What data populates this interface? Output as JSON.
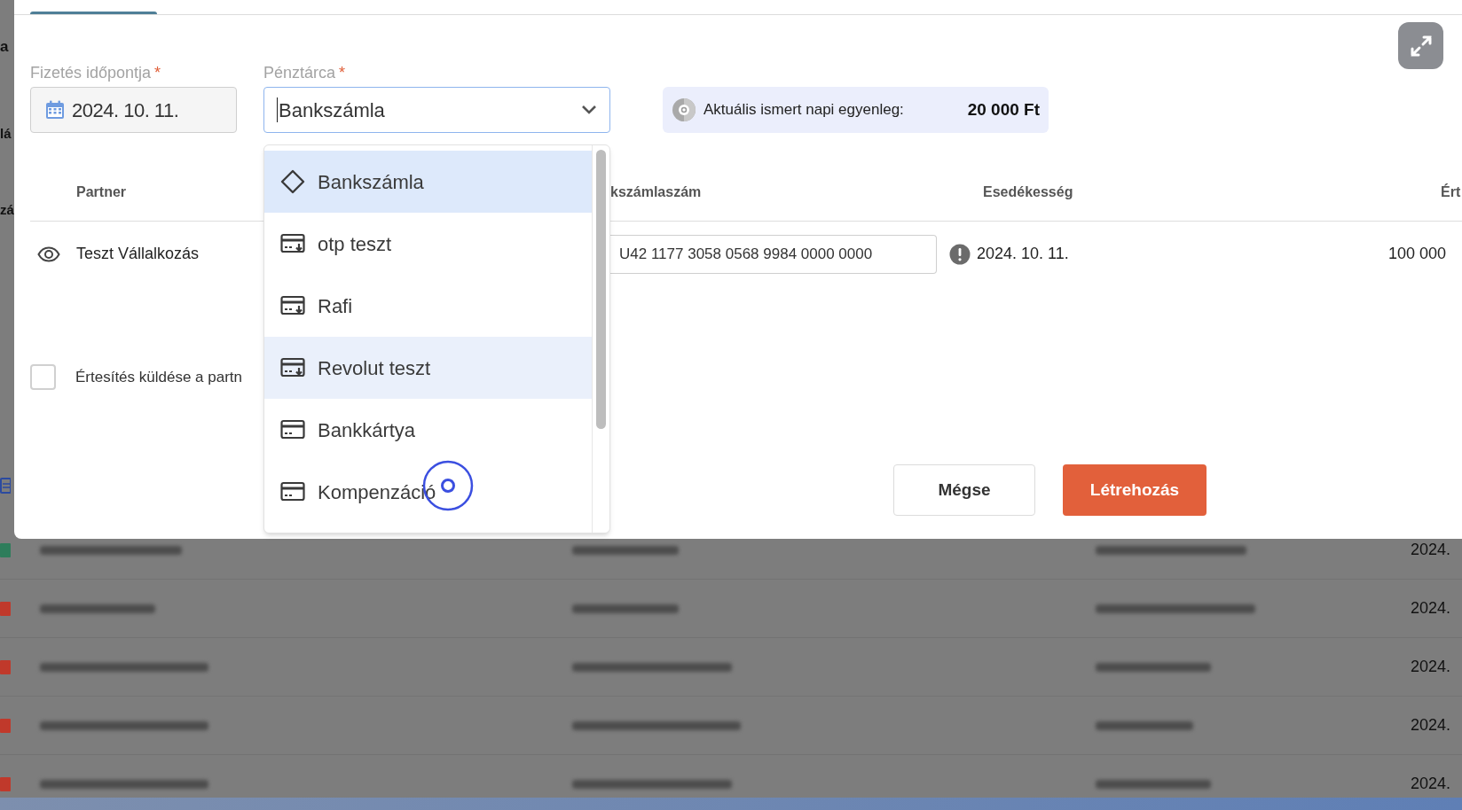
{
  "background": {
    "side_labels": [
      "a",
      "lá",
      "zá"
    ],
    "rows": [
      {
        "color": "#2e7d5b",
        "date": "2024."
      },
      {
        "color": "#c0392b",
        "date": "2024."
      },
      {
        "color": "#c0392b",
        "date": "2024."
      },
      {
        "color": "#c0392b",
        "date": "2024."
      },
      {
        "color": "#c0392b",
        "date": "2024."
      }
    ]
  },
  "dialog": {
    "date_field": {
      "label": "Fizetés időpontja",
      "required_mark": "*",
      "value": "2024. 10. 11."
    },
    "wallet_select": {
      "label": "Pénztárca",
      "required_mark": "*",
      "value": "Bankszámla"
    },
    "balance": {
      "label": "Aktuális ismert napi egyenleg:",
      "amount": "20 000 Ft"
    },
    "table": {
      "columns": [
        "Partner",
        "kszámlaszám",
        "Esedékesség",
        "Ért"
      ],
      "rows": [
        {
          "partner": "Teszt Vállalkozás",
          "account": "U42 1177 3058 0568 9984 0000 0000",
          "due": "2024. 10. 11.",
          "amount": "100 000"
        }
      ]
    },
    "notify": {
      "label": "Értesítés küldése a partn",
      "checked": false
    },
    "buttons": [
      {
        "label": "Mégse",
        "kind": "secondary"
      },
      {
        "label": "Létrehozás",
        "kind": "primary"
      }
    ],
    "dropdown": {
      "options": [
        {
          "label": "Bankszámla",
          "kind": "diamond",
          "selected": true,
          "hovered": false
        },
        {
          "label": "otp teszt",
          "kind": "card-in",
          "selected": false,
          "hovered": false
        },
        {
          "label": "Rafi",
          "kind": "card-in",
          "selected": false,
          "hovered": false
        },
        {
          "label": "Revolut teszt",
          "kind": "card-in",
          "selected": false,
          "hovered": true
        },
        {
          "label": "Bankkártya",
          "kind": "card",
          "selected": false,
          "hovered": false
        },
        {
          "label": "Kompenzáció",
          "kind": "card",
          "selected": false,
          "hovered": false
        }
      ]
    }
  }
}
